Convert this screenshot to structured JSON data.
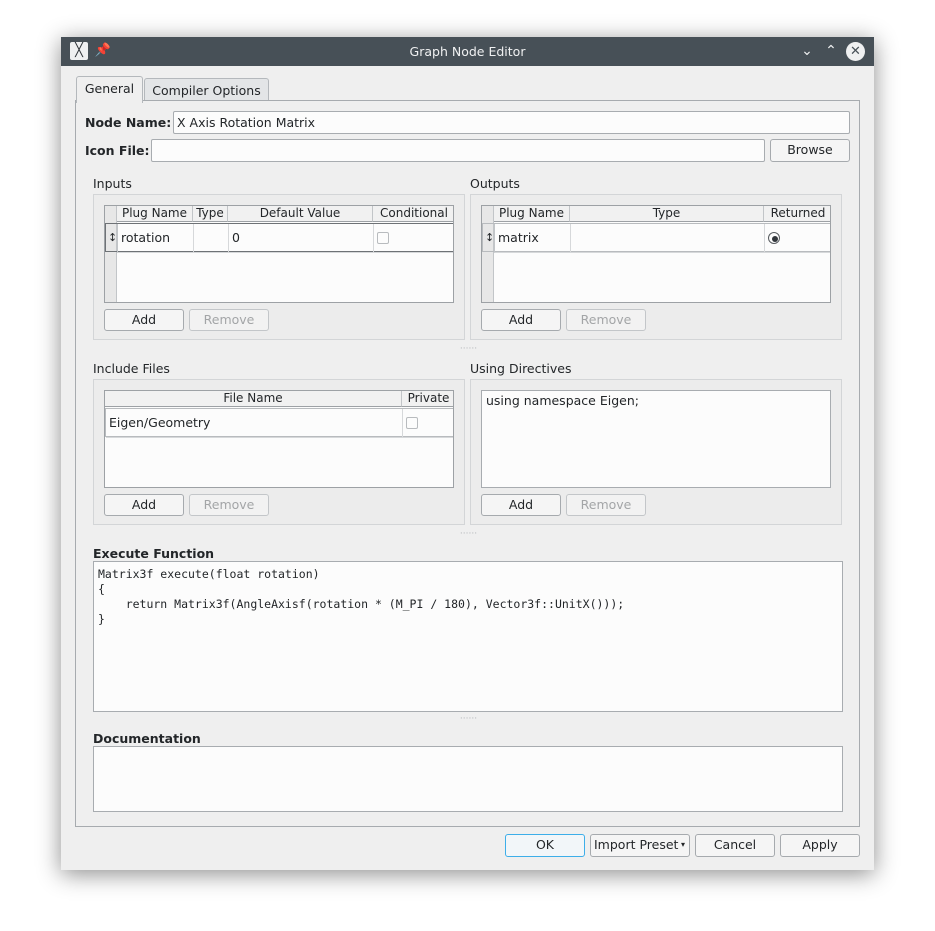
{
  "window": {
    "title": "Graph Node Editor",
    "titlebar_icons": [
      "app-icon",
      "pin-icon",
      "minimize-chevron-icon",
      "maximize-chevron-icon",
      "close-icon"
    ]
  },
  "tabs": [
    {
      "label": "General",
      "active": true
    },
    {
      "label": "Compiler Options",
      "active": false
    }
  ],
  "node_name": {
    "label": "Node Name:",
    "value": "X Axis Rotation Matrix"
  },
  "icon_file": {
    "label": "Icon File:",
    "value": "",
    "browse_label": "Browse"
  },
  "inputs": {
    "title": "Inputs",
    "columns": [
      "Plug Name",
      "Type",
      "Default Value",
      "Conditional"
    ],
    "rows": [
      {
        "handle": "↕",
        "plug_name": "rotation",
        "type": "",
        "default_value": "0",
        "conditional": false
      }
    ],
    "add_label": "Add",
    "remove_label": "Remove"
  },
  "outputs": {
    "title": "Outputs",
    "columns": [
      "Plug Name",
      "Type",
      "Returned"
    ],
    "rows": [
      {
        "handle": "↕",
        "plug_name": "matrix",
        "type": "",
        "returned": true
      }
    ],
    "add_label": "Add",
    "remove_label": "Remove"
  },
  "include_files": {
    "title": "Include Files",
    "columns": [
      "File Name",
      "Private"
    ],
    "rows": [
      {
        "file_name": "Eigen/Geometry",
        "private": false
      }
    ],
    "add_label": "Add",
    "remove_label": "Remove"
  },
  "using_directives": {
    "title": "Using Directives",
    "text": "using namespace Eigen;",
    "add_label": "Add",
    "remove_label": "Remove"
  },
  "execute_function": {
    "title": "Execute Function",
    "code": "Matrix3f execute(float rotation)\n{\n    return Matrix3f(AngleAxisf(rotation * (M_PI / 180), Vector3f::UnitX()));\n}"
  },
  "documentation": {
    "title": "Documentation",
    "text": ""
  },
  "footer": {
    "ok_label": "OK",
    "import_preset_label": "Import Preset",
    "cancel_label": "Cancel",
    "apply_label": "Apply"
  },
  "splitter_glyph": "······"
}
